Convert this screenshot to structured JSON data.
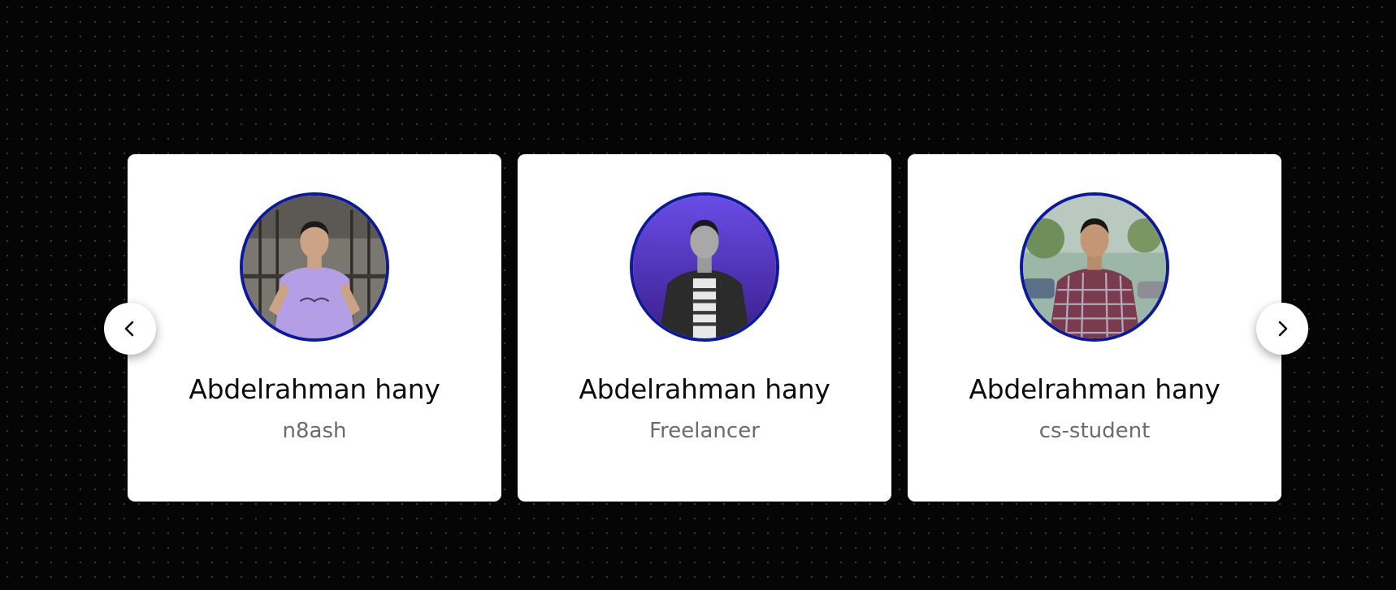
{
  "carousel": {
    "prev_icon": "chevron-left-icon",
    "next_icon": "chevron-right-icon",
    "cards": [
      {
        "name": "Abdelrahman hany",
        "role": "n8ash",
        "avatar": "profile-photo-lavender-shirt",
        "avatar_border_color": "#0c1a9a"
      },
      {
        "name": "Abdelrahman hany",
        "role": "Freelancer",
        "avatar": "profile-photo-purple-background",
        "avatar_border_color": "#0c1a9a"
      },
      {
        "name": "Abdelrahman hany",
        "role": "cs-student",
        "avatar": "profile-photo-plaid-shirt",
        "avatar_border_color": "#0c1a9a"
      }
    ]
  },
  "colors": {
    "page_background": "#050505",
    "card_background": "#ffffff",
    "name_text": "#0d0d0d",
    "role_text": "#6b6b6b",
    "accent_border": "#0c1a9a"
  }
}
